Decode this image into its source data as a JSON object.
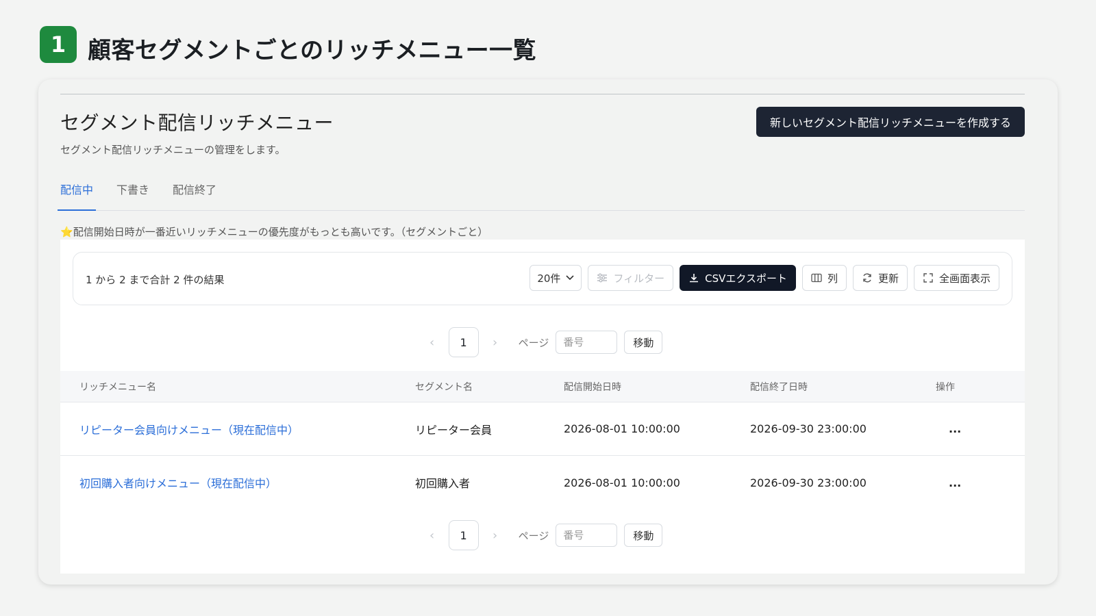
{
  "header": {
    "step": "1",
    "title": "顧客セグメントごとのリッチメニュー一覧"
  },
  "card": {
    "title": "セグメント配信リッチメニュー",
    "description": "セグメント配信リッチメニューの管理をします。",
    "create_button": "新しいセグメント配信リッチメニューを作成する"
  },
  "tabs": [
    {
      "label": "配信中",
      "active": true
    },
    {
      "label": "下書き",
      "active": false
    },
    {
      "label": "配信終了",
      "active": false
    }
  ],
  "note": {
    "star": "⭐",
    "text": "配信開始日時が一番近いリッチメニューの優先度がもっとも高いです。（セグメントごと）"
  },
  "toolbar": {
    "result_text": "1 から 2 まで合計 2 件の結果",
    "page_size": "20件",
    "filter_label": "フィルター",
    "csv_label": "CSVエクスポート",
    "columns_label": "列",
    "refresh_label": "更新",
    "fullscreen_label": "全画面表示"
  },
  "pagination": {
    "prev": "‹",
    "next": "›",
    "current_page": "1",
    "page_label": "ページ",
    "page_input_placeholder": "番号",
    "go_label": "移動"
  },
  "table": {
    "headers": [
      "リッチメニュー名",
      "セグメント名",
      "配信開始日時",
      "配信終了日時",
      "操作"
    ],
    "rows": [
      {
        "name": "リピーター会員向けメニュー（現在配信中）",
        "segment": "リピーター会員",
        "start": "2026-08-01 10:00:00",
        "end": "2026-09-30 23:00:00",
        "actions": "..."
      },
      {
        "name": "初回購入者向けメニュー（現在配信中）",
        "segment": "初回購入者",
        "start": "2026-08-01 10:00:00",
        "end": "2026-09-30 23:00:00",
        "actions": "..."
      }
    ]
  },
  "colors": {
    "step_badge": "#1e8a3e",
    "accent": "#2b6ed8",
    "dark_button": "#1d2433",
    "star": "#f5b800"
  },
  "icons": [
    "download-icon",
    "sliders-icon",
    "columns-icon",
    "refresh-icon",
    "fullscreen-icon",
    "chevron-down-icon"
  ]
}
